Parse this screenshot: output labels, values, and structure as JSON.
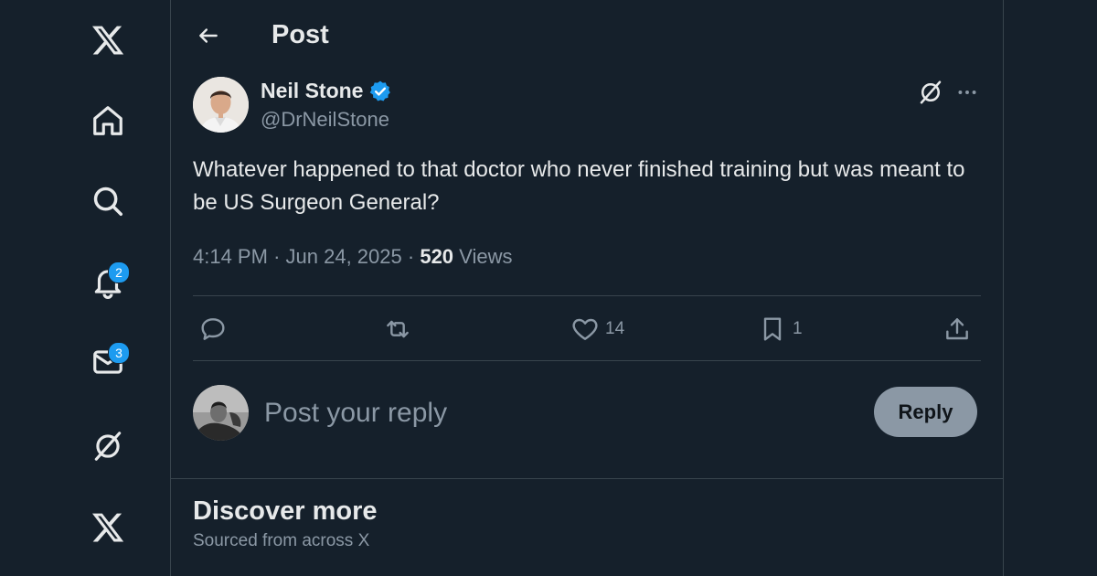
{
  "sidebar": {
    "notifications_badge": "2",
    "messages_badge": "3"
  },
  "header": {
    "title": "Post"
  },
  "post": {
    "author_name": "Neil Stone",
    "author_handle": "@DrNeilStone",
    "text": "Whatever  happened to that doctor who never finished training but was meant to be US Surgeon General?",
    "time": "4:14 PM",
    "date": "Jun 24, 2025",
    "views_count": "520",
    "views_label": "Views",
    "likes": "14",
    "bookmarks": "1"
  },
  "reply": {
    "placeholder": "Post your reply",
    "button_label": "Reply"
  },
  "discover": {
    "title": "Discover more",
    "subtitle": "Sourced from across X"
  },
  "colors": {
    "background": "#15202b",
    "accent": "#1d9bf0",
    "border": "#38444d",
    "secondary_text": "#8b98a5"
  }
}
